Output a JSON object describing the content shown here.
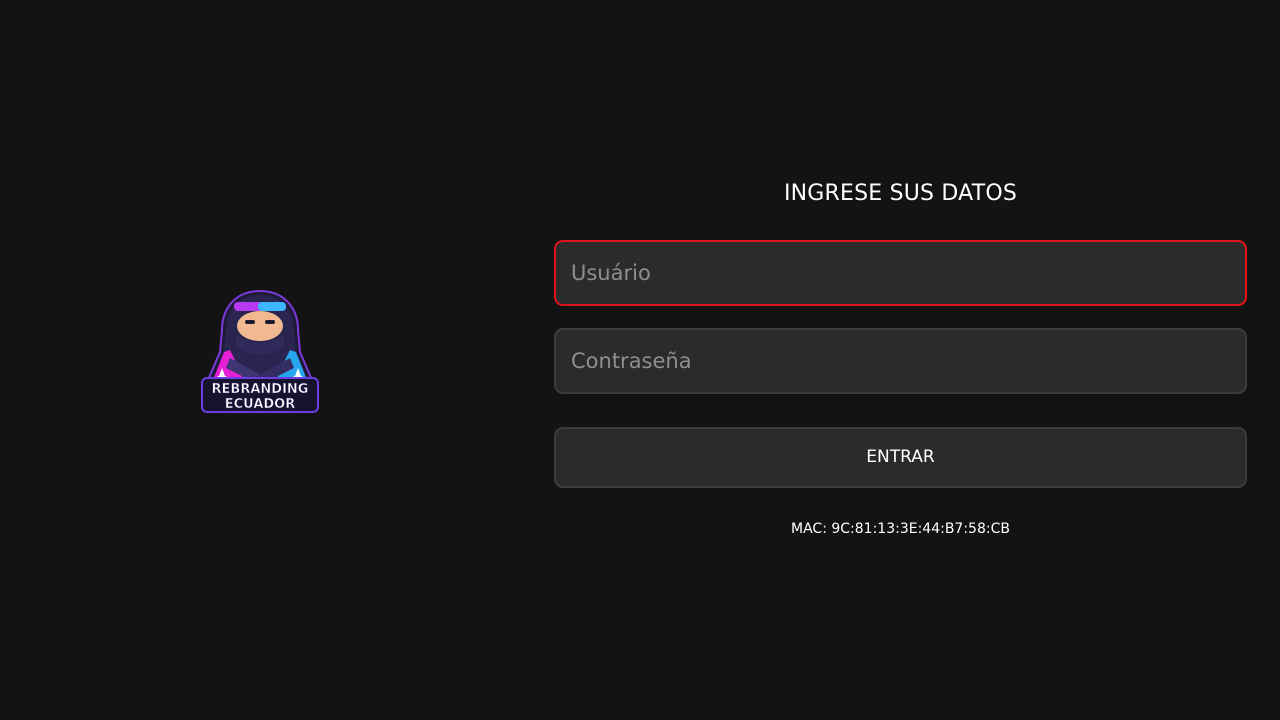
{
  "logo": {
    "icon": "ninja-mascot-logo",
    "line1": "REBRANDING",
    "line2": "ECUADOR"
  },
  "form": {
    "title": "INGRESE SUS DATOS",
    "username": {
      "placeholder": "Usuário",
      "value": ""
    },
    "password": {
      "placeholder": "Contraseña",
      "value": ""
    },
    "submit_label": "ENTRAR",
    "mac_label": "MAC: 9C:81:13:3E:44:B7:58:CB"
  },
  "colors": {
    "background": "#131313",
    "field_background": "#2b2b2b",
    "focus_border": "#e0141a",
    "logo_magenta": "#e61ed6",
    "logo_cyan": "#27a6f0",
    "logo_navy": "#2a2550"
  }
}
